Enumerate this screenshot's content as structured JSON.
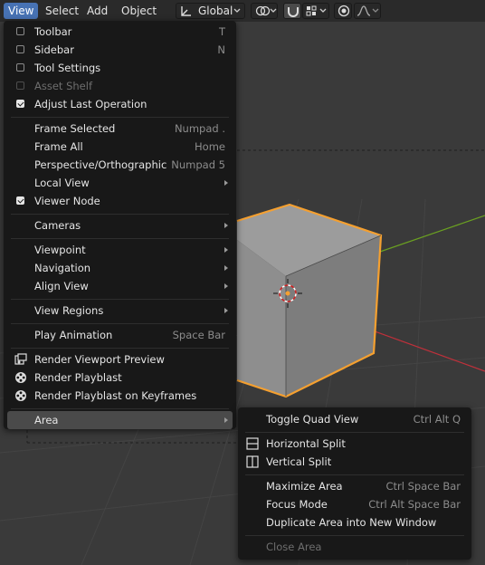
{
  "colors": {
    "accent": "#4772b3",
    "selection": "#f5a030",
    "menu_bg": "#181818",
    "x_axis": "#c0303a",
    "y_axis": "#6aa021"
  },
  "header": {
    "menus": [
      {
        "label": "View",
        "active": true
      },
      {
        "label": "Select"
      },
      {
        "label": "Add"
      },
      {
        "label": "Object"
      }
    ],
    "transform_orientation": {
      "label": "Global",
      "icon": "orientation-gizmo-icon"
    },
    "pivot_icon": "pivot-point-icon",
    "snap_icon": "snap-magnet-icon",
    "snap_target_icon": "snap-increment-icon",
    "proportional_icon": "proportional-edit-icon",
    "falloff_icon": "falloff-curve-icon"
  },
  "view_menu": {
    "items": [
      {
        "label": "Toolbar",
        "shortcut": "T",
        "checkbox": true,
        "checked": false
      },
      {
        "label": "Sidebar",
        "shortcut": "N",
        "checkbox": true,
        "checked": false
      },
      {
        "label": "Tool Settings",
        "checkbox": true,
        "checked": false
      },
      {
        "label": "Asset Shelf",
        "checkbox": true,
        "checked": false,
        "disabled": true
      },
      {
        "label": "Adjust Last Operation",
        "checkbox": true,
        "checked": true
      },
      {
        "label": "Frame Selected",
        "shortcut": "Numpad ."
      },
      {
        "label": "Frame All",
        "shortcut": "Home"
      },
      {
        "label": "Perspective/Orthographic",
        "shortcut": "Numpad 5"
      },
      {
        "label": "Local View",
        "submenu": true
      },
      {
        "label": "Viewer Node",
        "checkbox": true,
        "checked": true
      },
      {
        "label": "Cameras",
        "submenu": true
      },
      {
        "label": "Viewpoint",
        "submenu": true
      },
      {
        "label": "Navigation",
        "submenu": true
      },
      {
        "label": "Align View",
        "submenu": true
      },
      {
        "label": "View Regions",
        "submenu": true
      },
      {
        "label": "Play Animation",
        "shortcut": "Space Bar"
      },
      {
        "label": "Render Viewport Preview",
        "icon": "render-still-icon"
      },
      {
        "label": "Render Playblast",
        "icon": "render-animation-icon"
      },
      {
        "label": "Render Playblast on Keyframes",
        "icon": "render-animation-icon"
      },
      {
        "label": "Area",
        "submenu": true,
        "highlighted": true
      }
    ]
  },
  "area_menu": {
    "items": [
      {
        "label": "Toggle Quad View",
        "shortcut": "Ctrl Alt Q"
      },
      {
        "label": "Horizontal Split",
        "icon": "split-horizontal-icon"
      },
      {
        "label": "Vertical Split",
        "icon": "split-vertical-icon"
      },
      {
        "label": "Maximize Area",
        "shortcut": "Ctrl Space Bar"
      },
      {
        "label": "Focus Mode",
        "shortcut": "Ctrl Alt Space Bar"
      },
      {
        "label": "Duplicate Area into New Window"
      },
      {
        "label": "Close Area",
        "disabled": true
      }
    ]
  }
}
